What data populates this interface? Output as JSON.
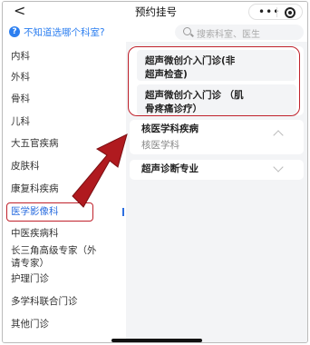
{
  "nav": {
    "back": "<",
    "title": "预约挂号",
    "more": "•••"
  },
  "helper": {
    "question_icon": "?",
    "text": "不知道选哪个科室?",
    "search_placeholder": "搜索科室、医生"
  },
  "departments": [
    {
      "label": "内科"
    },
    {
      "label": "外科"
    },
    {
      "label": "骨科"
    },
    {
      "label": "儿科"
    },
    {
      "label": "大五官疾病"
    },
    {
      "label": "皮肤科"
    },
    {
      "label": "康复科疾病"
    },
    {
      "label": "医学影像科"
    },
    {
      "label": "中医疾病科"
    },
    {
      "label": "长三角高级专家（外",
      "line2": "请专家）"
    },
    {
      "label": "护理门诊"
    },
    {
      "label": "多学科联合门诊"
    },
    {
      "label": "其他门诊"
    }
  ],
  "panel": {
    "sub_items": [
      {
        "line1": "超声微创介入门诊(非",
        "line2": "超声检查)"
      },
      {
        "line1": "超声微创介入门诊 （肌",
        "line2": "骨疼痛诊疗）"
      }
    ],
    "group1": {
      "title": "核医学科疾病",
      "subtitle": "核医学科"
    },
    "group2": {
      "title": "超声诊断专业"
    }
  },
  "colors": {
    "accent": "#2d6fe0",
    "highlight_box": "#c0212b",
    "arrow": "#b01a1f"
  }
}
